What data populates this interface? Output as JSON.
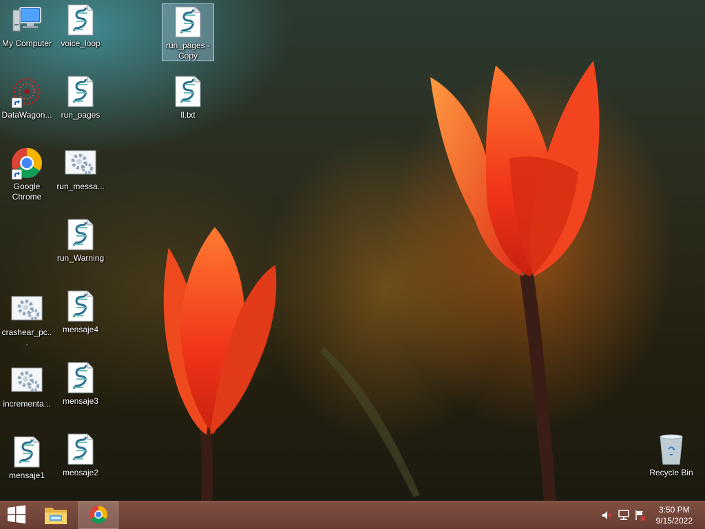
{
  "desktop": {
    "icons": [
      {
        "label": "My Computer",
        "icon": "computer-icon"
      },
      {
        "label": "voice_loop",
        "icon": "script-file-icon"
      },
      {
        "label": "run_pages - Copy",
        "icon": "script-file-icon",
        "selected": true
      },
      {
        "label": "DataWagon...",
        "icon": "datawagon-icon",
        "shortcut": true
      },
      {
        "label": "run_pages",
        "icon": "script-file-icon"
      },
      {
        "label": "ll.txt",
        "icon": "script-file-icon"
      },
      {
        "label": "Google Chrome",
        "icon": "chrome-icon",
        "shortcut": true
      },
      {
        "label": "run_messa...",
        "icon": "settings-file-icon"
      },
      {
        "label": "run_Warning",
        "icon": "script-file-icon"
      },
      {
        "label": "crashear_pc...",
        "icon": "settings-file-icon"
      },
      {
        "label": "mensaje4",
        "icon": "script-file-icon"
      },
      {
        "label": "incrementa...",
        "icon": "settings-file-icon"
      },
      {
        "label": "mensaje3",
        "icon": "script-file-icon"
      },
      {
        "label": "mensaje1",
        "icon": "script-file-icon"
      },
      {
        "label": "mensaje2",
        "icon": "script-file-icon"
      },
      {
        "label": "Recycle Bin",
        "icon": "recycle-bin-icon"
      }
    ]
  },
  "taskbar": {
    "start": {
      "icon": "windows-start-icon"
    },
    "pinned": [
      {
        "icon": "file-explorer-icon"
      },
      {
        "icon": "chrome-icon",
        "active": true
      }
    ],
    "tray": {
      "icons": [
        "speaker-muted-icon",
        "network-icon",
        "action-center-flag-icon"
      ],
      "time": "3:50 PM",
      "date": "9/15/2022"
    }
  },
  "colors": {
    "taskbar": "#6e3d30",
    "selection": "#aad2eb"
  }
}
